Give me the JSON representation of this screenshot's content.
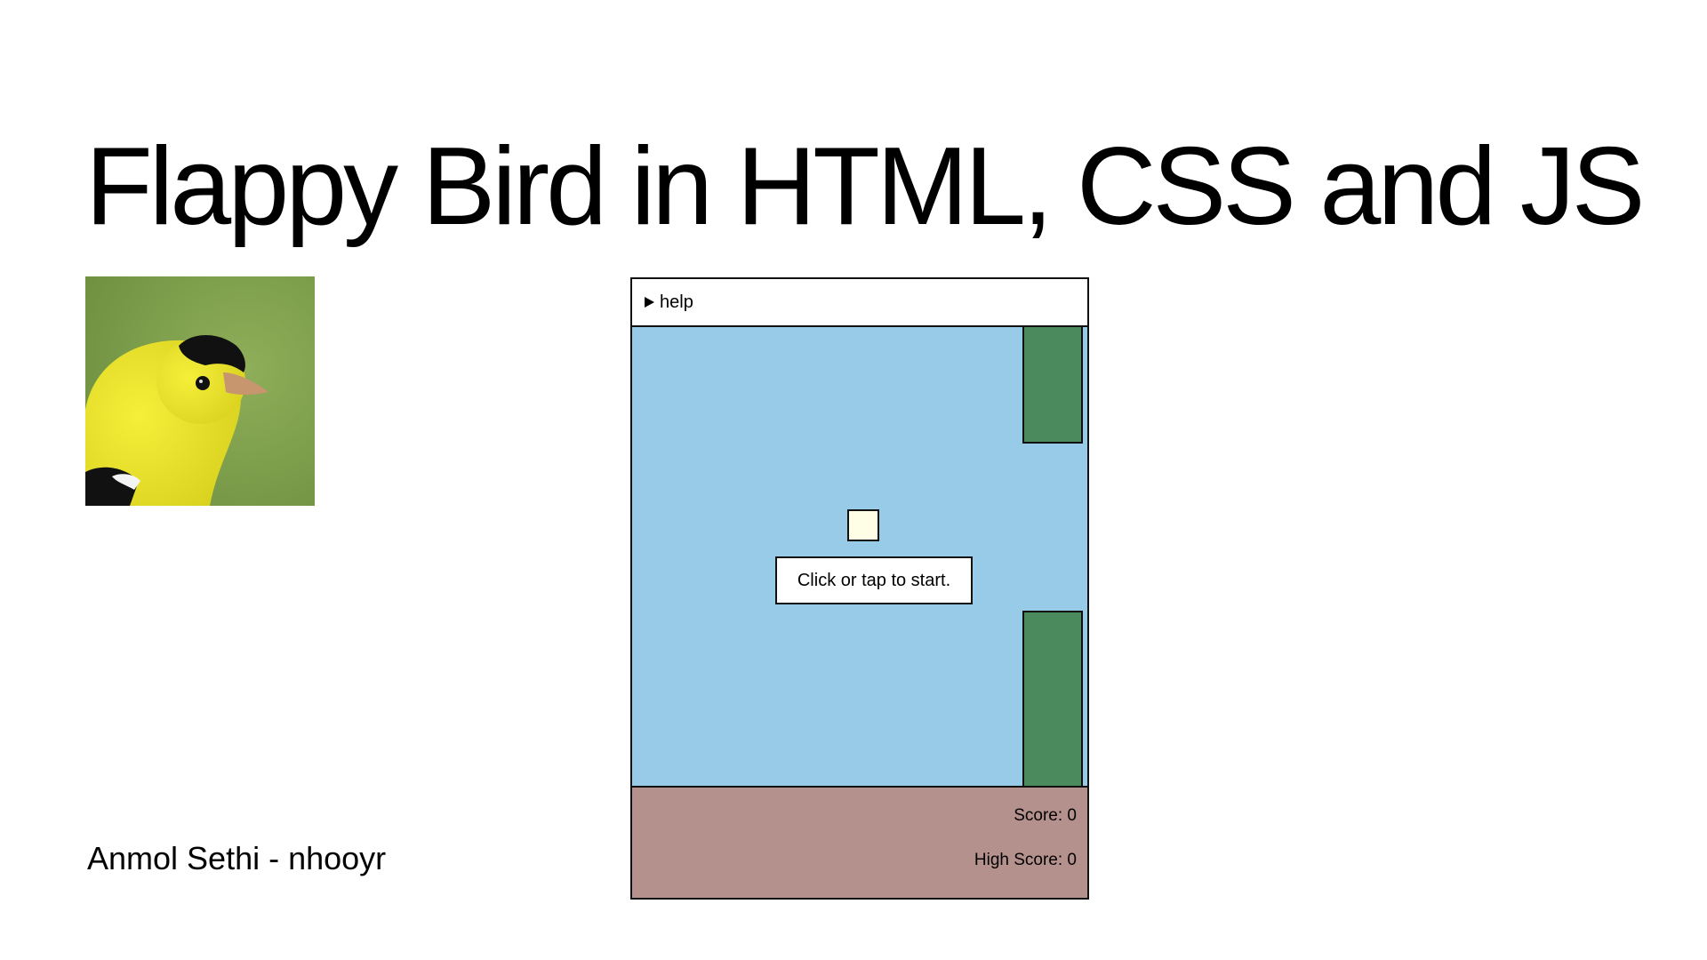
{
  "slide": {
    "title": "Flappy Bird in HTML, CSS and JS",
    "author": "Anmol Sethi - nhooyr"
  },
  "game": {
    "help_label": "help",
    "start_prompt": "Click or tap to start.",
    "score_text": "Score: 0",
    "high_score_text": "High Score: 0"
  },
  "colors": {
    "sky": "#98cbe8",
    "pipe": "#4a8a5c",
    "ground": "#b5918d",
    "bird": "#fefee6"
  }
}
